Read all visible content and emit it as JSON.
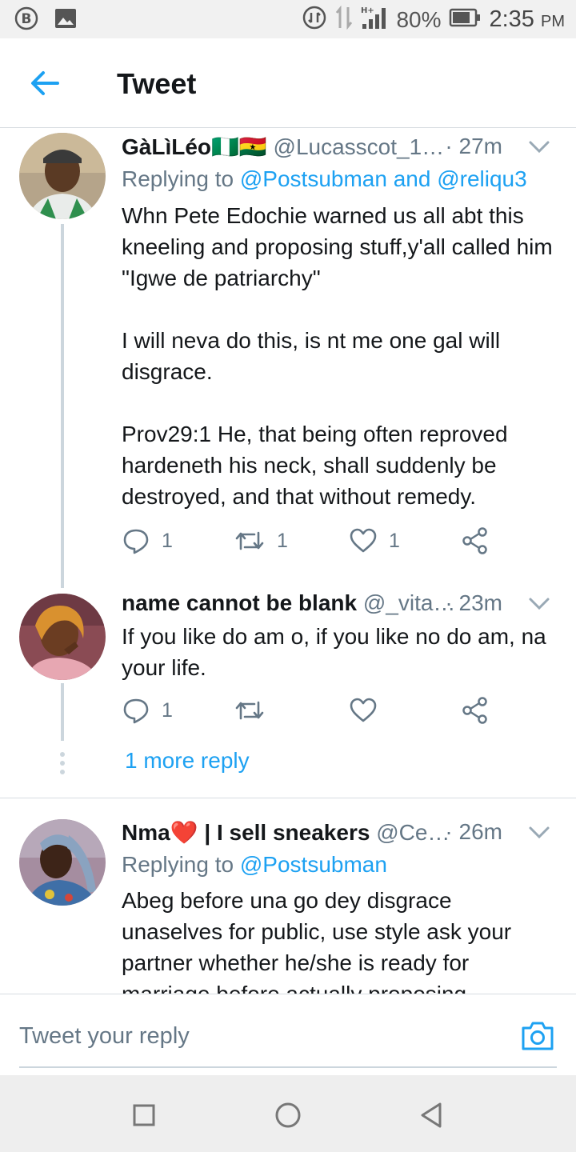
{
  "status_bar": {
    "battery_percent": "80%",
    "time": "2:35",
    "ampm": "PM",
    "network": "H+"
  },
  "header": {
    "title": "Tweet"
  },
  "tweets": [
    {
      "name": "GàLìLéo🇳🇬🇬🇭",
      "handle": "@Lucasscot_1…",
      "time": "· 27m",
      "reply_prefix": "Replying to ",
      "reply_to": "@Postsubman and @reliqu3",
      "body": [
        "Whn Pete Edochie warned us all abt this kneeling and proposing stuff,y'all called him \"Igwe de patriarchy\"",
        "I will neva do this, is nt me one gal  will disgrace.",
        "Prov29:1 He, that being often reproved hardeneth his neck, shall suddenly be destroyed, and that without remedy."
      ],
      "reply_count": "1",
      "retweet_count": "1",
      "like_count": "1"
    },
    {
      "name": "name cannot be blank",
      "handle": "@_vita…",
      "time": "· 23m",
      "body": [
        "If you like do am o, if you like no do am, na your life."
      ],
      "reply_count": "1",
      "retweet_count": "",
      "like_count": ""
    },
    {
      "name": "Nma❤️ | I sell sneakers",
      "handle": "@Ce…",
      "time": "· 26m",
      "reply_prefix": "Replying to ",
      "reply_to": "@Postsubman",
      "body": [
        "Abeg before una go dey disgrace unaselves for public, use style ask your partner whether he/she is ready for marriage before actually proposing"
      ]
    }
  ],
  "more_replies": "1 more reply",
  "reply_bar": {
    "placeholder": "Tweet your reply"
  },
  "colors": {
    "accent": "#1da1f2",
    "secondary_text": "#657786",
    "divider": "#d8dde1"
  },
  "icons": [
    "back-arrow-icon",
    "reply-icon",
    "retweet-icon",
    "like-icon",
    "share-icon",
    "chevron-down-icon",
    "camera-icon",
    "nav-recents-icon",
    "nav-home-icon",
    "nav-back-icon"
  ]
}
